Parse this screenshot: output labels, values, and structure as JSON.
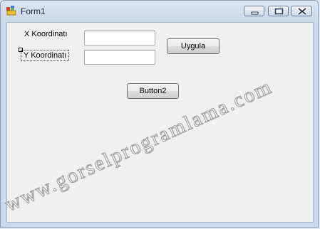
{
  "window": {
    "title": "Form1",
    "icon": "form-app-icon",
    "caption_buttons": [
      "minimize-icon",
      "maximize-icon",
      "close-icon"
    ]
  },
  "form": {
    "x_label": "X Koordinatı",
    "y_label": "Y Koordinatı",
    "x_value": "",
    "y_value": "",
    "apply_button": "Uygula",
    "button2": "Button2"
  },
  "watermark": "www.gorselprogramlama.com"
}
